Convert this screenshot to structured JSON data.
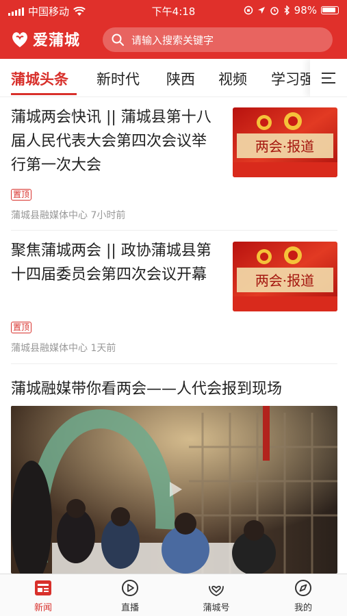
{
  "status_bar": {
    "carrier": "中国移动",
    "time": "下午4:18",
    "battery": "98%"
  },
  "header": {
    "app_name": "爱蒲城",
    "search_placeholder": "请输入搜索关键字"
  },
  "tabs": [
    {
      "label": "蒲城头条",
      "active": true
    },
    {
      "label": "新时代",
      "active": false
    },
    {
      "label": "陕西",
      "active": false
    },
    {
      "label": "视频",
      "active": false
    },
    {
      "label": "学习强",
      "active": false
    }
  ],
  "articles": [
    {
      "title": "蒲城两会快讯 || 蒲城县第十八届人民代表大会第四次会议举行第一次大会",
      "tag": "置顶",
      "source": "蒲城县融媒体中心",
      "time": "7小时前",
      "thumb_text": "两会·报道"
    },
    {
      "title": "聚焦蒲城两会 || 政协蒲城县第十四届委员会第四次会议开幕",
      "tag": "置顶",
      "source": "蒲城县融媒体中心",
      "time": "1天前",
      "thumb_text": "两会·报道"
    }
  ],
  "video_article": {
    "title": "蒲城融媒带你看两会——人代会报到现场"
  },
  "bottom_nav": [
    {
      "label": "新闻",
      "icon": "news-icon",
      "active": true
    },
    {
      "label": "直播",
      "icon": "live-play-icon",
      "active": false
    },
    {
      "label": "蒲城号",
      "icon": "heart-hands-icon",
      "active": false
    },
    {
      "label": "我的",
      "icon": "compass-icon",
      "active": false
    }
  ],
  "colors": {
    "brand_red": "#e0302b",
    "active_text": "#d8302b"
  }
}
